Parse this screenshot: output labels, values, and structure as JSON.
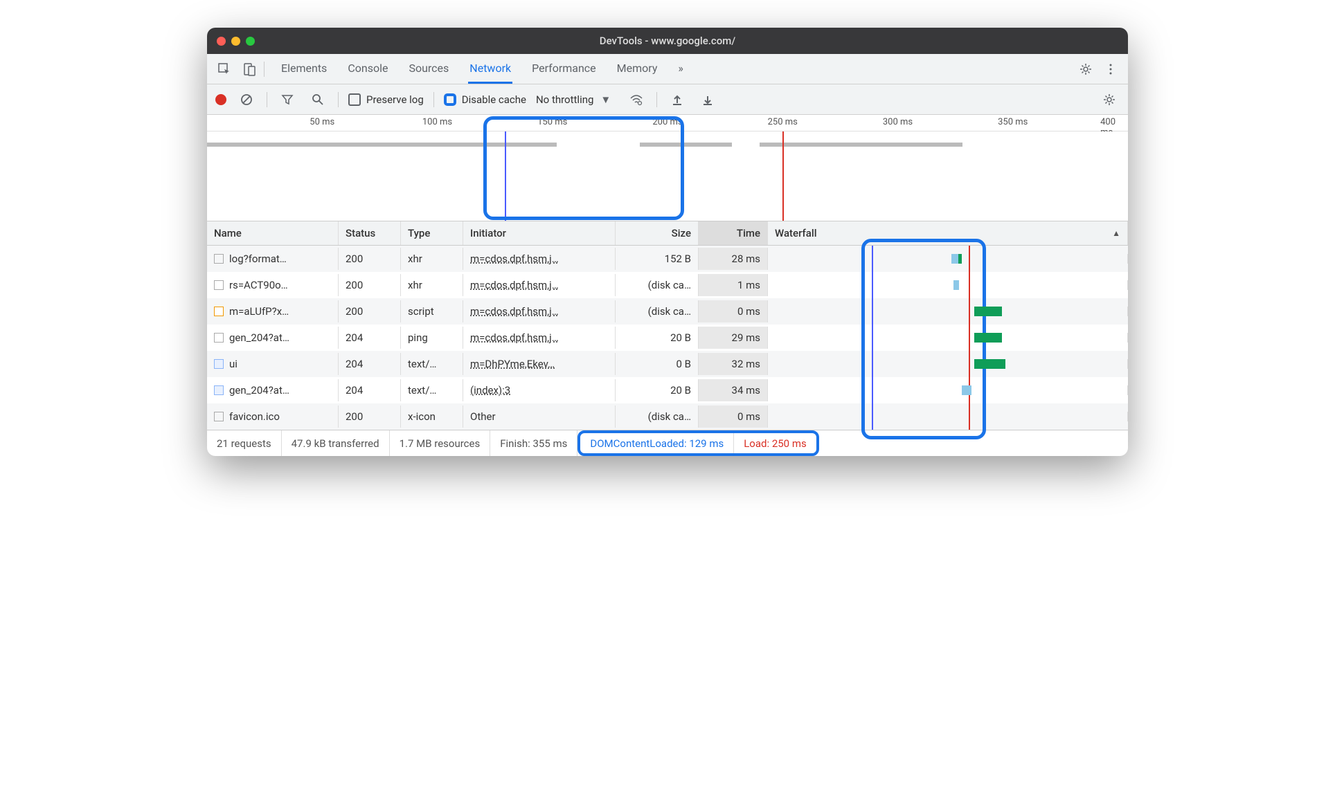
{
  "window": {
    "title": "DevTools - www.google.com/"
  },
  "tabs": {
    "items": [
      "Elements",
      "Console",
      "Sources",
      "Network",
      "Performance",
      "Memory"
    ],
    "active": "Network",
    "more": "»"
  },
  "toolbar": {
    "preserve_log": "Preserve log",
    "disable_cache": "Disable cache",
    "throttling": "No throttling"
  },
  "timeline": {
    "ticks": [
      "50 ms",
      "100 ms",
      "150 ms",
      "200 ms",
      "250 ms",
      "300 ms",
      "350 ms",
      "400 ms"
    ]
  },
  "columns": {
    "name": "Name",
    "status": "Status",
    "type": "Type",
    "initiator": "Initiator",
    "size": "Size",
    "time": "Time",
    "waterfall": "Waterfall"
  },
  "rows": [
    {
      "name": "log?format…",
      "status": "200",
      "type": "xhr",
      "initiator": "m=cdos,dpf,hsm,j…",
      "size": "152 B",
      "time": "28 ms",
      "icon": "plain"
    },
    {
      "name": "rs=ACT90o…",
      "status": "200",
      "type": "xhr",
      "initiator": "m=cdos,dpf,hsm,j…",
      "size": "(disk ca…",
      "time": "1 ms",
      "icon": "plain"
    },
    {
      "name": "m=aLUfP?x…",
      "status": "200",
      "type": "script",
      "initiator": "m=cdos,dpf,hsm,j…",
      "size": "(disk ca…",
      "time": "0 ms",
      "icon": "js"
    },
    {
      "name": "gen_204?at…",
      "status": "204",
      "type": "ping",
      "initiator": "m=cdos,dpf,hsm,j…",
      "size": "20 B",
      "time": "29 ms",
      "icon": "plain"
    },
    {
      "name": "ui",
      "status": "204",
      "type": "text/…",
      "initiator": "m=DhPYme,Ekev…",
      "size": "0 B",
      "time": "32 ms",
      "icon": "img"
    },
    {
      "name": "gen_204?at…",
      "status": "204",
      "type": "text/…",
      "initiator": "(index):3",
      "size": "20 B",
      "time": "34 ms",
      "icon": "img"
    },
    {
      "name": "favicon.ico",
      "status": "200",
      "type": "x-icon",
      "initiator": "Other",
      "size": "(disk ca…",
      "time": "0 ms",
      "icon": "plain"
    }
  ],
  "footer": {
    "requests": "21 requests",
    "transferred": "47.9 kB transferred",
    "resources": "1.7 MB resources",
    "finish": "Finish: 355 ms",
    "dcl": "DOMContentLoaded: 129 ms",
    "load": "Load: 250 ms"
  }
}
